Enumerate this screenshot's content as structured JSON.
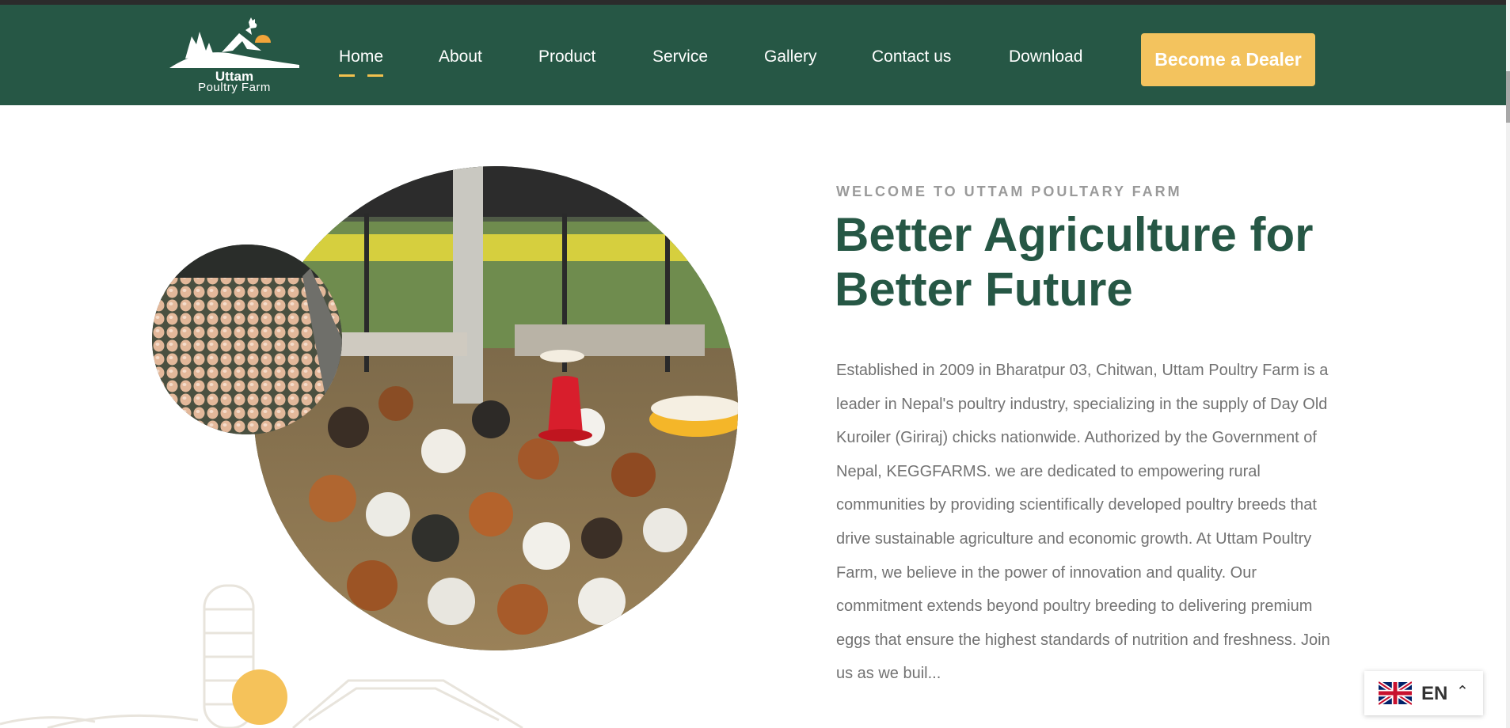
{
  "brand": {
    "name_line1": "Uttam",
    "name_line2": "Poultry Farm"
  },
  "nav": {
    "items": [
      {
        "label": "Home",
        "active": true
      },
      {
        "label": "About"
      },
      {
        "label": "Product"
      },
      {
        "label": "Service"
      },
      {
        "label": "Gallery"
      },
      {
        "label": "Contact us"
      },
      {
        "label": "Download"
      }
    ],
    "cta_label": "Become a Dealer"
  },
  "hero": {
    "eyebrow": "WELCOME TO UTTAM POULTARY FARM",
    "heading": "Better Agriculture for Better Future",
    "paragraph": "Established in 2009 in Bharatpur 03, Chitwan, Uttam Poultry Farm is a leader in Nepal's poultry industry, specializing in the supply of Day Old Kuroiler (Giriraj) chicks nationwide. Authorized by the Government of Nepal, KEGGFARMS. we are dedicated to empowering rural communities by providing scientifically developed poultry breeds that drive sustainable agriculture and economic growth. At Uttam Poultry Farm, we believe in the power of innovation and quality. Our commitment extends beyond poultry breeding to delivering premium eggs that ensure the highest standards of nutrition and freshness. Join us as we buil..."
  },
  "language": {
    "code": "EN",
    "flag_icon": "uk-flag-icon",
    "chevron_icon": "chevron-up-icon"
  },
  "colors": {
    "nav_bg": "#265745",
    "accent": "#f3c35e",
    "heading": "#265745",
    "text_muted": "#727272"
  }
}
